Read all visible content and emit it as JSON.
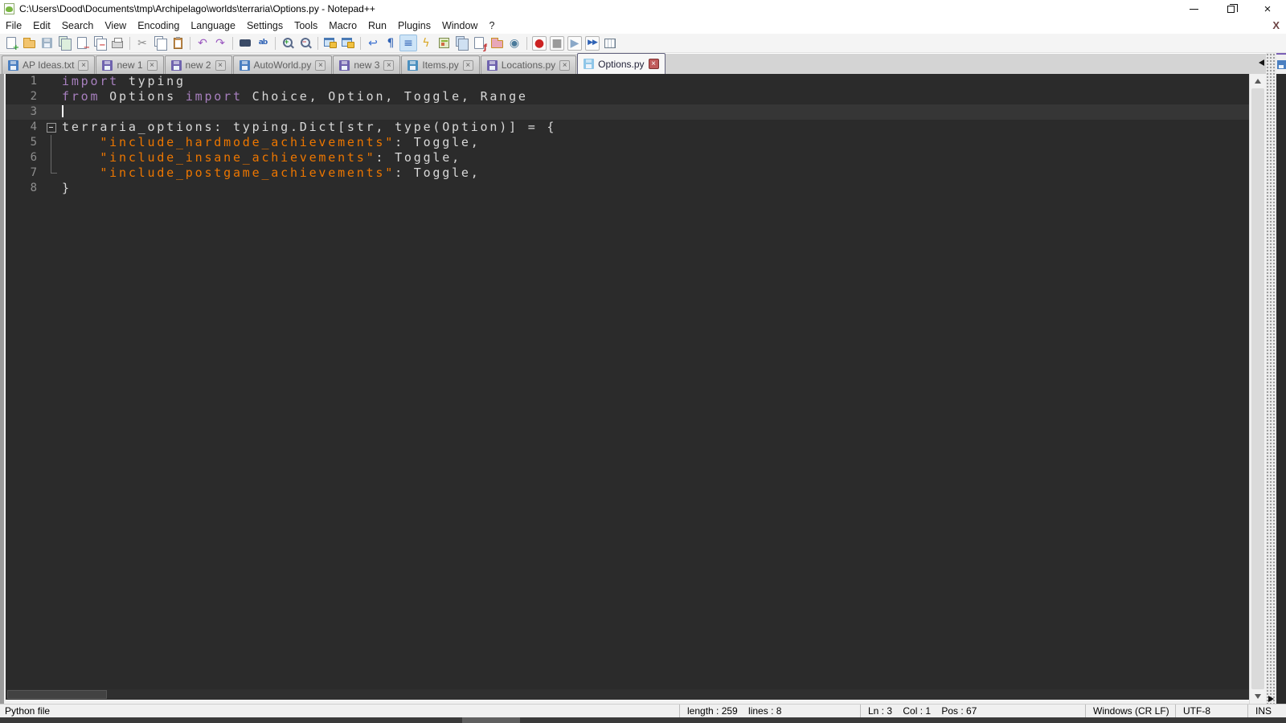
{
  "window": {
    "title": "C:\\Users\\Dood\\Documents\\tmp\\Archipelago\\worlds\\terraria\\Options.py - Notepad++",
    "controls": [
      "minimize",
      "restore",
      "close"
    ],
    "menu_row_close": "X"
  },
  "menu": {
    "items": [
      "File",
      "Edit",
      "Search",
      "View",
      "Encoding",
      "Language",
      "Settings",
      "Tools",
      "Macro",
      "Run",
      "Plugins",
      "Window",
      "?"
    ]
  },
  "toolbar": {
    "icons": [
      {
        "name": "new-file",
        "kind": "page",
        "badge": "+",
        "badge_color": "#2a9d2a"
      },
      {
        "name": "open-file",
        "kind": "folder",
        "color": "#f2c46d"
      },
      {
        "name": "save-file",
        "kind": "floppy",
        "color": "#9fb3c6"
      },
      {
        "name": "save-all",
        "kind": "pages",
        "tint": "#ddeedd"
      },
      {
        "name": "close-file",
        "kind": "page",
        "badge": "−",
        "badge_color": "#d04545"
      },
      {
        "name": "close-all",
        "kind": "pages",
        "badge": "−",
        "badge_color": "#d04545"
      },
      {
        "name": "print",
        "kind": "printer"
      },
      {
        "sep": true
      },
      {
        "name": "cut",
        "kind": "glyph",
        "glyph": "✂",
        "color": "#8a8a8a"
      },
      {
        "name": "copy",
        "kind": "pages"
      },
      {
        "name": "paste",
        "kind": "clipboard"
      },
      {
        "sep": true
      },
      {
        "name": "undo",
        "kind": "glyph",
        "glyph": "↶",
        "color": "#9b59c0"
      },
      {
        "name": "redo",
        "kind": "glyph",
        "glyph": "↷",
        "color": "#9b59c0"
      },
      {
        "sep": true
      },
      {
        "name": "find",
        "kind": "binoculars"
      },
      {
        "name": "replace",
        "kind": "glyph",
        "glyph": "ab",
        "color": "#2f62b5",
        "small": true
      },
      {
        "sep": true
      },
      {
        "name": "zoom-in",
        "kind": "magnifier",
        "sign": "+",
        "color": "#2a9d2a"
      },
      {
        "name": "zoom-out",
        "kind": "magnifier",
        "sign": "−",
        "color": "#d04545"
      },
      {
        "sep": true
      },
      {
        "name": "sync-vertical-scrolling",
        "kind": "winlock"
      },
      {
        "name": "sync-horizontal-scrolling",
        "kind": "winlock"
      },
      {
        "sep": true
      },
      {
        "name": "word-wrap",
        "kind": "glyph",
        "glyph": "↩",
        "color": "#3a6fd0"
      },
      {
        "name": "show-all-characters",
        "kind": "glyph",
        "glyph": "¶",
        "color": "#2f62b5"
      },
      {
        "name": "show-indent-guide",
        "kind": "glyph",
        "glyph": "≡",
        "color": "#2f62b5",
        "pressed": true
      },
      {
        "name": "define-your-language",
        "kind": "glyph",
        "glyph": "ϟ",
        "color": "#d9a520"
      },
      {
        "name": "document-map",
        "kind": "map"
      },
      {
        "name": "document-list",
        "kind": "pages",
        "tint": "#cfe0f2"
      },
      {
        "name": "function-list",
        "kind": "page",
        "badge": "ƒ",
        "badge_color": "#c03030"
      },
      {
        "name": "folder-as-workspace",
        "kind": "folder",
        "color": "#e8a8b8"
      },
      {
        "name": "monitoring",
        "kind": "glyph",
        "glyph": "◉",
        "color": "#4a7a9a"
      },
      {
        "sep": true
      },
      {
        "name": "macro-record",
        "kind": "glyph",
        "glyph": "●",
        "color": "#cc2222",
        "boxed": true
      },
      {
        "name": "macro-stop",
        "kind": "glyph",
        "glyph": "■",
        "color": "#9a9a9a",
        "boxed": true
      },
      {
        "name": "macro-play",
        "kind": "glyph",
        "glyph": "▶",
        "color": "#8aa8c8",
        "boxed": true
      },
      {
        "name": "macro-run-multiple",
        "kind": "glyph",
        "glyph": "▶▶",
        "color": "#2f62b5",
        "small": true,
        "boxed": true
      },
      {
        "name": "macro-save",
        "kind": "grid"
      }
    ]
  },
  "tabs": {
    "close_glyph": "×",
    "items": [
      {
        "label": "AP Ideas.txt",
        "icon_color": "#4a7fc1",
        "active": false
      },
      {
        "label": "new 1",
        "icon_color": "#6f63ae",
        "active": false
      },
      {
        "label": "new 2",
        "icon_color": "#6f63ae",
        "active": false
      },
      {
        "label": "AutoWorld.py",
        "icon_color": "#4a7fc1",
        "active": false
      },
      {
        "label": "new 3",
        "icon_color": "#6f63ae",
        "active": false
      },
      {
        "label": "Items.py",
        "icon_color": "#4a8fbf",
        "active": false
      },
      {
        "label": "Locations.py",
        "icon_color": "#6f63ae",
        "active": false
      },
      {
        "label": "Options.py",
        "icon_color": "#8fc6e8",
        "active": true
      }
    ]
  },
  "editor": {
    "lines": [
      {
        "n": "1",
        "fold": "",
        "seg": [
          [
            "kw",
            "import"
          ],
          [
            "d",
            " typing"
          ]
        ]
      },
      {
        "n": "2",
        "fold": "",
        "seg": [
          [
            "kw",
            "from"
          ],
          [
            "d",
            " Options "
          ],
          [
            "kw",
            "import"
          ],
          [
            "d",
            " Choice, Option, Toggle, Range"
          ]
        ]
      },
      {
        "n": "3",
        "fold": "",
        "seg": [],
        "current": true,
        "caret": true
      },
      {
        "n": "4",
        "fold": "minus",
        "seg": [
          [
            "d",
            "terraria_options: typing.Dict[str, type(Option)] = {"
          ]
        ]
      },
      {
        "n": "5",
        "fold": "line",
        "seg": [
          [
            "d",
            "    "
          ],
          [
            "s",
            "\"include_hardmode_achievements\""
          ],
          [
            "d",
            ": Toggle,"
          ]
        ]
      },
      {
        "n": "6",
        "fold": "line",
        "seg": [
          [
            "d",
            "    "
          ],
          [
            "s",
            "\"include_insane_achievements\""
          ],
          [
            "d",
            ": Toggle,"
          ]
        ]
      },
      {
        "n": "7",
        "fold": "end",
        "seg": [
          [
            "d",
            "    "
          ],
          [
            "s",
            "\"include_postgame_achievements\""
          ],
          [
            "d",
            ": Toggle,"
          ]
        ]
      },
      {
        "n": "8",
        "fold": "",
        "seg": [
          [
            "d",
            "}"
          ]
        ]
      }
    ]
  },
  "colors": {
    "keyword": "#a77fbe",
    "string": "#ec7600",
    "default_text": "#d8d8d8",
    "editor_background": "#2b2b2b",
    "current_line_background": "#363636",
    "line_number": "#8e8e8e",
    "active_tab_close": "#c05b5b"
  },
  "status_bar": {
    "doc_type": "Python file",
    "length_info": "length : 259    lines : 8",
    "cursor_info": "Ln : 3    Col : 1    Pos : 67",
    "eol": "Windows (CR LF)",
    "encoding": "UTF-8",
    "typing_mode": "INS"
  }
}
